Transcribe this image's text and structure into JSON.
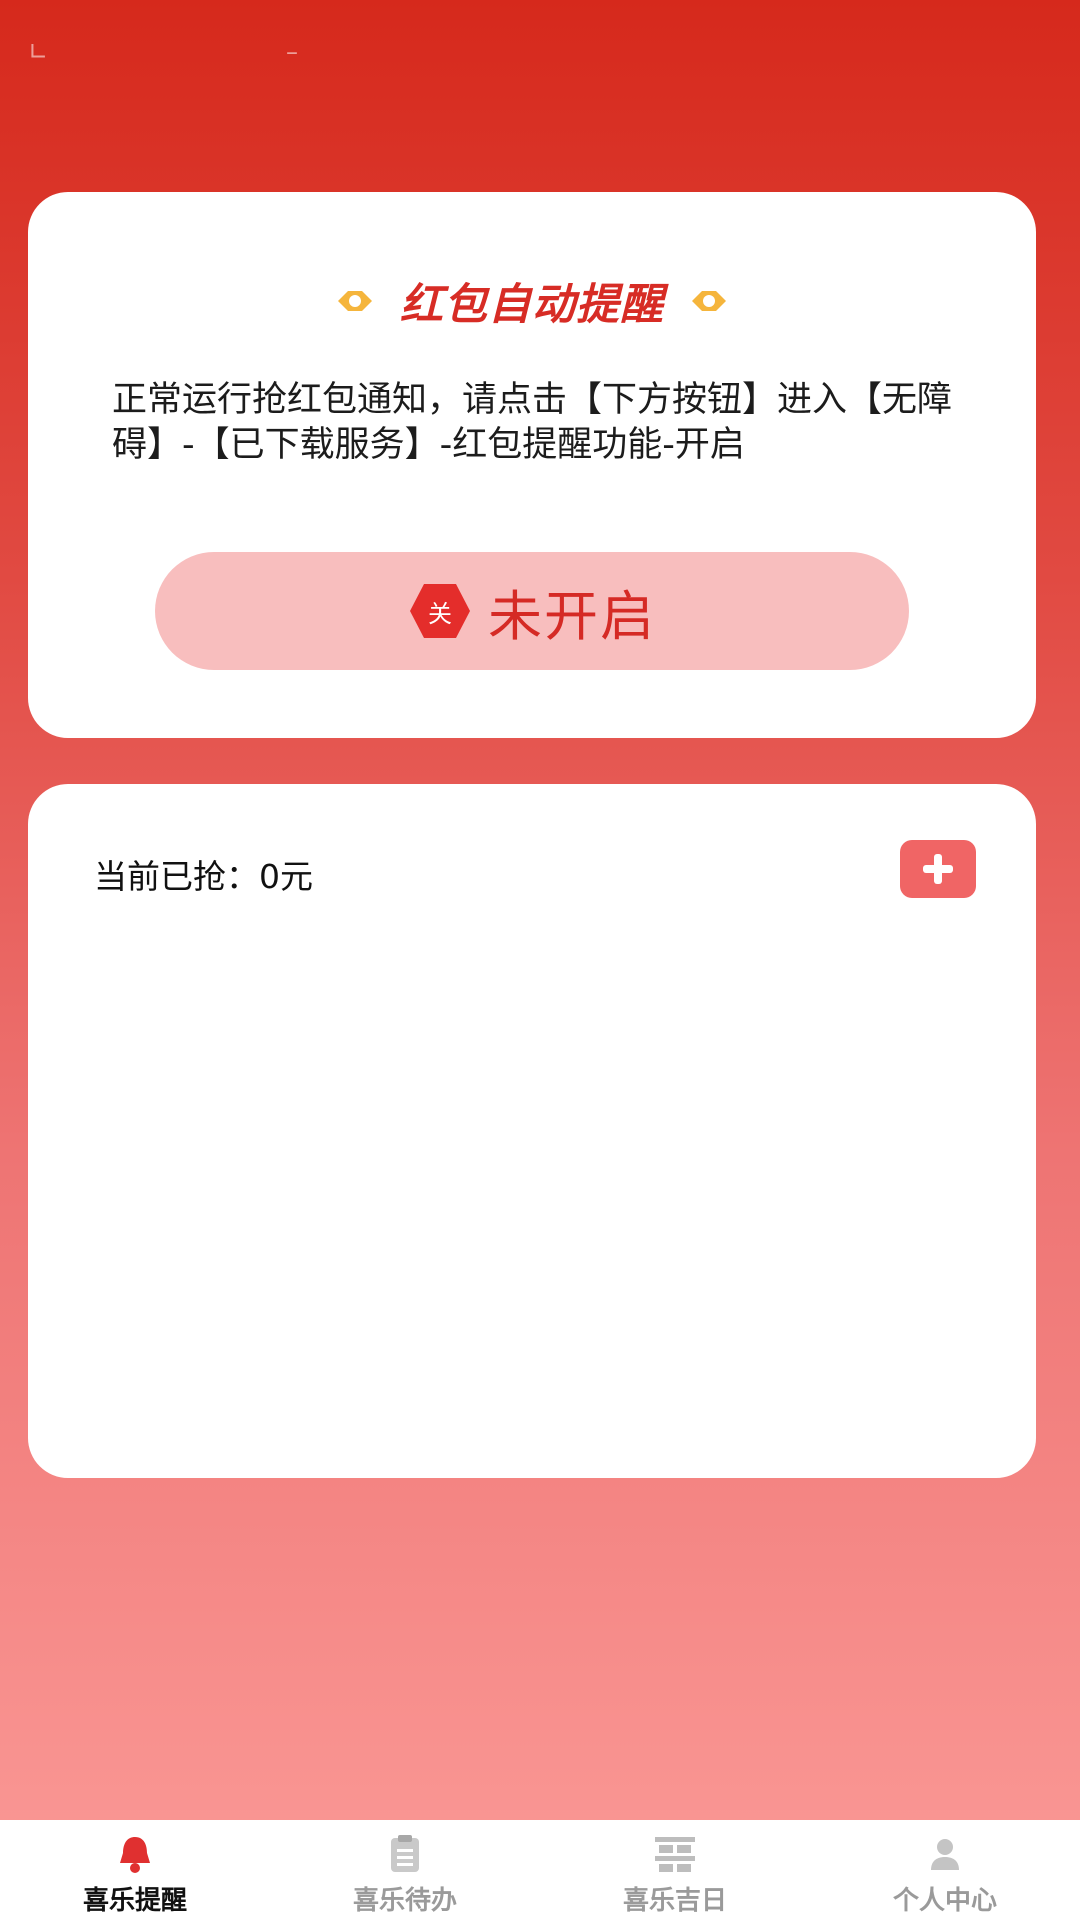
{
  "status_bar": {
    "left_marks": "∟",
    "center_mark": "–"
  },
  "reminder_card": {
    "title": "红包自动提醒",
    "description": "正常运行抢红包通知，请点击【下方按钮】进入【无障碍】-【已下载服务】-红包提醒功能-开启",
    "toggle": {
      "badge_text": "关",
      "label": "未开启"
    }
  },
  "stats_card": {
    "grabbed_label": "当前已抢：0元",
    "add_icon": "plus-icon"
  },
  "tab_bar": {
    "tabs": [
      {
        "label": "喜乐提醒",
        "icon": "bell-icon",
        "active": true
      },
      {
        "label": "喜乐待办",
        "icon": "clipboard-icon",
        "active": false
      },
      {
        "label": "喜乐吉日",
        "icon": "double-happiness-icon",
        "active": false
      },
      {
        "label": "个人中心",
        "icon": "person-icon",
        "active": false
      }
    ]
  },
  "colors": {
    "accent": "#d72c25",
    "toggle_bg": "#f8bebe",
    "add_button": "#f06565",
    "ornament": "#f5b53c"
  }
}
